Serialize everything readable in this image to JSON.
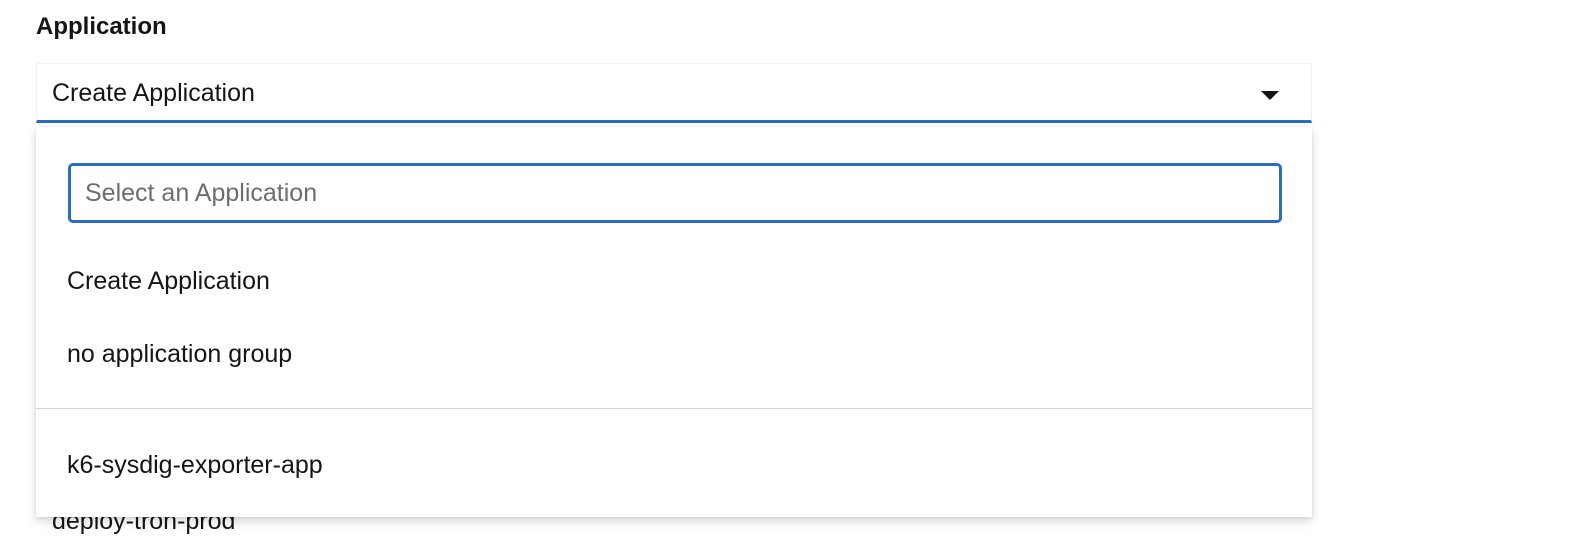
{
  "field": {
    "label": "Application"
  },
  "select": {
    "selected_value": "Create Application"
  },
  "menu": {
    "search_placeholder": "Select an Application",
    "items": [
      {
        "label": "Create Application"
      },
      {
        "label": "no application group"
      },
      {
        "label": "k6-sysdig-exporter-app"
      }
    ]
  },
  "background": {
    "partial_text": "deploy-tron-prod"
  },
  "colors": {
    "accent": "#2b6cc4",
    "text": "#151515",
    "placeholder": "#6a6e73",
    "divider": "#d2d2d2"
  },
  "icons": {
    "toggle": "caret-down-icon"
  }
}
